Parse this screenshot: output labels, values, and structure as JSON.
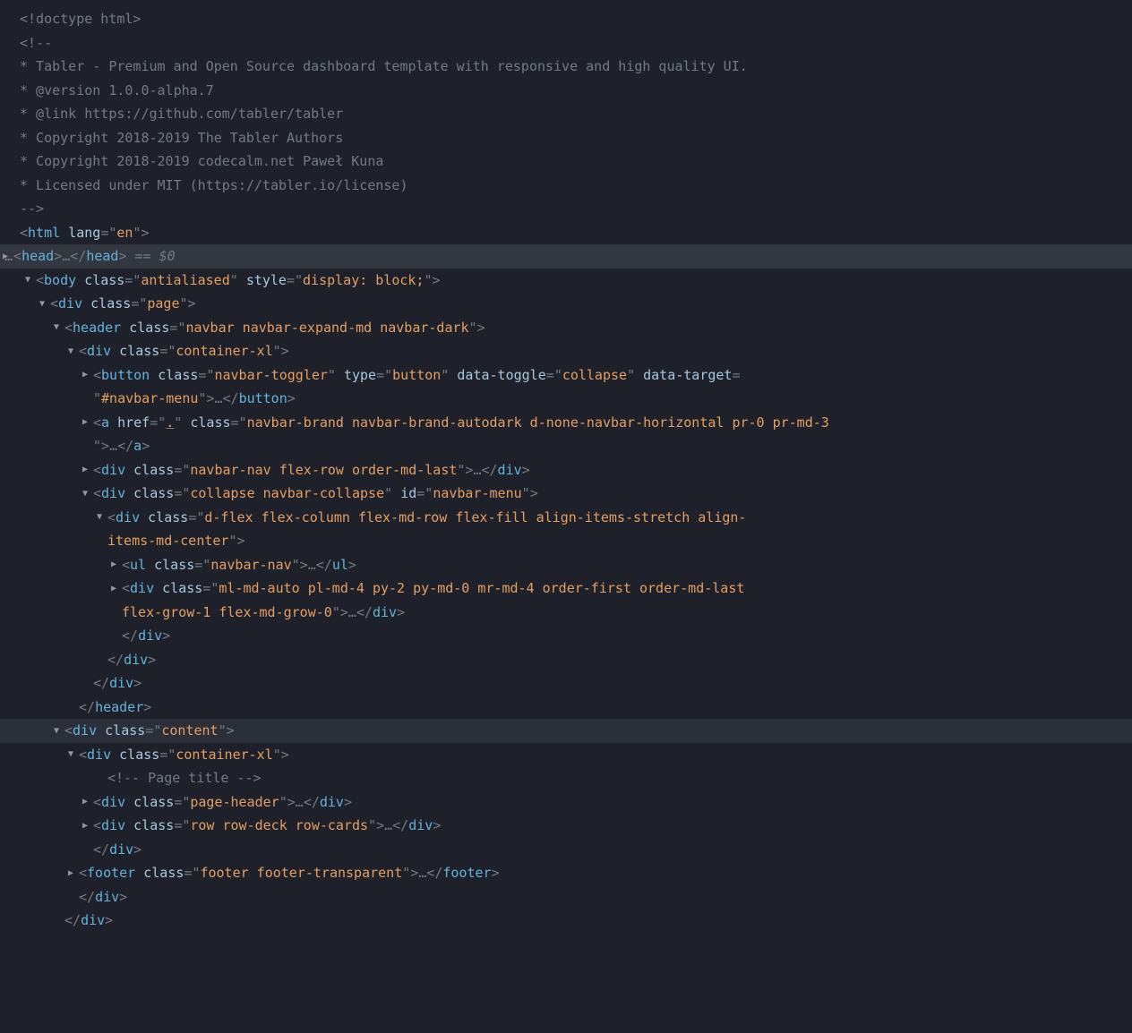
{
  "doctype": "<!doctype html>",
  "comment_lines": [
    "<!--",
    "* Tabler - Premium and Open Source dashboard template with responsive and high quality UI.",
    "* @version 1.0.0-alpha.7",
    "* @link https://github.com/tabler/tabler",
    "* Copyright 2018-2019 The Tabler Authors",
    "* Copyright 2018-2019 codecalm.net Paweł Kuna",
    "* Licensed under MIT (https://tabler.io/license)",
    "-->"
  ],
  "html_open": {
    "tag": "html",
    "attrs": [
      [
        "lang",
        "en"
      ]
    ]
  },
  "head_sel": {
    "prefix": "…",
    "tag": "head",
    "inner": "…",
    "suffix": " == $0"
  },
  "body_open": {
    "tag": "body",
    "attrs": [
      [
        "class",
        "antialiased"
      ],
      [
        "style",
        "display: block;"
      ]
    ]
  },
  "page_open": {
    "tag": "div",
    "attrs": [
      [
        "class",
        "page"
      ]
    ]
  },
  "header_open": {
    "tag": "header",
    "attrs": [
      [
        "class",
        "navbar navbar-expand-md navbar-dark"
      ]
    ]
  },
  "container1_open": {
    "tag": "div",
    "attrs": [
      [
        "class",
        "container-xl"
      ]
    ]
  },
  "button_line": {
    "tag": "button",
    "attrs": [
      [
        "class",
        "navbar-toggler"
      ],
      [
        "type",
        "button"
      ],
      [
        "data-toggle",
        "collapse"
      ],
      [
        "data-target",
        "#navbar-menu"
      ]
    ],
    "ellipsis": "…"
  },
  "a_line": {
    "tag": "a",
    "href": ".",
    "attrs": [
      [
        "class",
        "navbar-brand navbar-brand-autodark d-none-navbar-horizontal pr-0 pr-md-3"
      ]
    ],
    "ellipsis": "…"
  },
  "nav_flex_line": {
    "tag": "div",
    "attrs": [
      [
        "class",
        "navbar-nav flex-row order-md-last"
      ]
    ],
    "ellipsis": "…"
  },
  "collapse_open": {
    "tag": "div",
    "attrs": [
      [
        "class",
        "collapse navbar-collapse"
      ],
      [
        "id",
        "navbar-menu"
      ]
    ]
  },
  "dflex_open": {
    "tag": "div",
    "attrs": [
      [
        "class",
        "d-flex flex-column flex-md-row flex-fill align-items-stretch align-items-md-center"
      ]
    ]
  },
  "ul_line": {
    "tag": "ul",
    "attrs": [
      [
        "class",
        "navbar-nav"
      ]
    ],
    "ellipsis": "…"
  },
  "mlauto_line": {
    "tag": "div",
    "attrs": [
      [
        "class",
        "ml-md-auto pl-md-4 py-2 py-md-0 mr-md-4 order-first order-md-last flex-grow-1 flex-md-grow-0"
      ]
    ],
    "ellipsis": "…"
  },
  "content_open": {
    "tag": "div",
    "attrs": [
      [
        "class",
        "content"
      ]
    ]
  },
  "container2_open": {
    "tag": "div",
    "attrs": [
      [
        "class",
        "container-xl"
      ]
    ]
  },
  "page_title_comment": "<!-- Page title -->",
  "page_header_line": {
    "tag": "div",
    "attrs": [
      [
        "class",
        "page-header"
      ]
    ],
    "ellipsis": "…"
  },
  "row_deck_line": {
    "tag": "div",
    "attrs": [
      [
        "class",
        "row row-deck row-cards"
      ]
    ],
    "ellipsis": "…"
  },
  "footer_line": {
    "tag": "footer",
    "attrs": [
      [
        "class",
        "footer footer-transparent"
      ]
    ],
    "ellipsis": "…"
  },
  "close_div": "</div>",
  "close_header": "</header>",
  "glyphs": {
    "open": "▼",
    "closed": "▶"
  }
}
